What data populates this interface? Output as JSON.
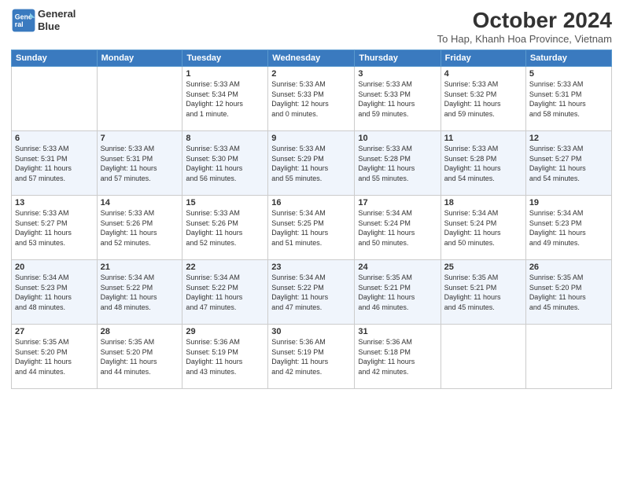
{
  "header": {
    "logo_line1": "General",
    "logo_line2": "Blue",
    "month": "October 2024",
    "location": "To Hap, Khanh Hoa Province, Vietnam"
  },
  "weekdays": [
    "Sunday",
    "Monday",
    "Tuesday",
    "Wednesday",
    "Thursday",
    "Friday",
    "Saturday"
  ],
  "weeks": [
    [
      {
        "day": "",
        "info": ""
      },
      {
        "day": "",
        "info": ""
      },
      {
        "day": "1",
        "info": "Sunrise: 5:33 AM\nSunset: 5:34 PM\nDaylight: 12 hours\nand 1 minute."
      },
      {
        "day": "2",
        "info": "Sunrise: 5:33 AM\nSunset: 5:33 PM\nDaylight: 12 hours\nand 0 minutes."
      },
      {
        "day": "3",
        "info": "Sunrise: 5:33 AM\nSunset: 5:33 PM\nDaylight: 11 hours\nand 59 minutes."
      },
      {
        "day": "4",
        "info": "Sunrise: 5:33 AM\nSunset: 5:32 PM\nDaylight: 11 hours\nand 59 minutes."
      },
      {
        "day": "5",
        "info": "Sunrise: 5:33 AM\nSunset: 5:31 PM\nDaylight: 11 hours\nand 58 minutes."
      }
    ],
    [
      {
        "day": "6",
        "info": "Sunrise: 5:33 AM\nSunset: 5:31 PM\nDaylight: 11 hours\nand 57 minutes."
      },
      {
        "day": "7",
        "info": "Sunrise: 5:33 AM\nSunset: 5:31 PM\nDaylight: 11 hours\nand 57 minutes."
      },
      {
        "day": "8",
        "info": "Sunrise: 5:33 AM\nSunset: 5:30 PM\nDaylight: 11 hours\nand 56 minutes."
      },
      {
        "day": "9",
        "info": "Sunrise: 5:33 AM\nSunset: 5:29 PM\nDaylight: 11 hours\nand 55 minutes."
      },
      {
        "day": "10",
        "info": "Sunrise: 5:33 AM\nSunset: 5:28 PM\nDaylight: 11 hours\nand 55 minutes."
      },
      {
        "day": "11",
        "info": "Sunrise: 5:33 AM\nSunset: 5:28 PM\nDaylight: 11 hours\nand 54 minutes."
      },
      {
        "day": "12",
        "info": "Sunrise: 5:33 AM\nSunset: 5:27 PM\nDaylight: 11 hours\nand 54 minutes."
      }
    ],
    [
      {
        "day": "13",
        "info": "Sunrise: 5:33 AM\nSunset: 5:27 PM\nDaylight: 11 hours\nand 53 minutes."
      },
      {
        "day": "14",
        "info": "Sunrise: 5:33 AM\nSunset: 5:26 PM\nDaylight: 11 hours\nand 52 minutes."
      },
      {
        "day": "15",
        "info": "Sunrise: 5:33 AM\nSunset: 5:26 PM\nDaylight: 11 hours\nand 52 minutes."
      },
      {
        "day": "16",
        "info": "Sunrise: 5:34 AM\nSunset: 5:25 PM\nDaylight: 11 hours\nand 51 minutes."
      },
      {
        "day": "17",
        "info": "Sunrise: 5:34 AM\nSunset: 5:24 PM\nDaylight: 11 hours\nand 50 minutes."
      },
      {
        "day": "18",
        "info": "Sunrise: 5:34 AM\nSunset: 5:24 PM\nDaylight: 11 hours\nand 50 minutes."
      },
      {
        "day": "19",
        "info": "Sunrise: 5:34 AM\nSunset: 5:23 PM\nDaylight: 11 hours\nand 49 minutes."
      }
    ],
    [
      {
        "day": "20",
        "info": "Sunrise: 5:34 AM\nSunset: 5:23 PM\nDaylight: 11 hours\nand 48 minutes."
      },
      {
        "day": "21",
        "info": "Sunrise: 5:34 AM\nSunset: 5:22 PM\nDaylight: 11 hours\nand 48 minutes."
      },
      {
        "day": "22",
        "info": "Sunrise: 5:34 AM\nSunset: 5:22 PM\nDaylight: 11 hours\nand 47 minutes."
      },
      {
        "day": "23",
        "info": "Sunrise: 5:34 AM\nSunset: 5:22 PM\nDaylight: 11 hours\nand 47 minutes."
      },
      {
        "day": "24",
        "info": "Sunrise: 5:35 AM\nSunset: 5:21 PM\nDaylight: 11 hours\nand 46 minutes."
      },
      {
        "day": "25",
        "info": "Sunrise: 5:35 AM\nSunset: 5:21 PM\nDaylight: 11 hours\nand 45 minutes."
      },
      {
        "day": "26",
        "info": "Sunrise: 5:35 AM\nSunset: 5:20 PM\nDaylight: 11 hours\nand 45 minutes."
      }
    ],
    [
      {
        "day": "27",
        "info": "Sunrise: 5:35 AM\nSunset: 5:20 PM\nDaylight: 11 hours\nand 44 minutes."
      },
      {
        "day": "28",
        "info": "Sunrise: 5:35 AM\nSunset: 5:20 PM\nDaylight: 11 hours\nand 44 minutes."
      },
      {
        "day": "29",
        "info": "Sunrise: 5:36 AM\nSunset: 5:19 PM\nDaylight: 11 hours\nand 43 minutes."
      },
      {
        "day": "30",
        "info": "Sunrise: 5:36 AM\nSunset: 5:19 PM\nDaylight: 11 hours\nand 42 minutes."
      },
      {
        "day": "31",
        "info": "Sunrise: 5:36 AM\nSunset: 5:18 PM\nDaylight: 11 hours\nand 42 minutes."
      },
      {
        "day": "",
        "info": ""
      },
      {
        "day": "",
        "info": ""
      }
    ]
  ]
}
